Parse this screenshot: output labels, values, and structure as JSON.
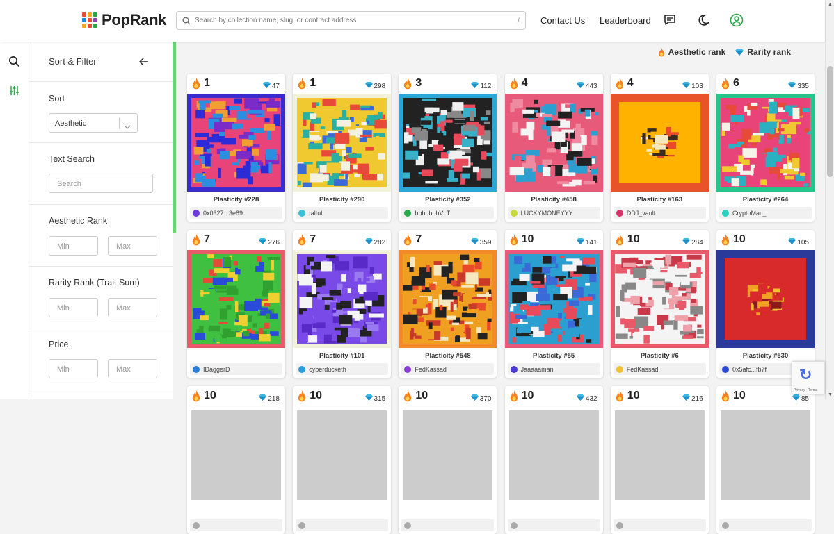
{
  "app": {
    "name": "PopRank",
    "logo_colors": [
      "#e84a3a",
      "#f5a623",
      "#2aa64b",
      "#1e88e5",
      "#e84a3a",
      "#8e44ad",
      "#f5a623",
      "#e84a3a",
      "#2aa64b"
    ]
  },
  "header": {
    "search_placeholder": "Search by collection name, slug, or contract address",
    "search_shortcut": "/",
    "contact_label": "Contact Us",
    "leaderboard_label": "Leaderboard"
  },
  "sidebar": {
    "title": "Sort & Filter",
    "sort_label": "Sort",
    "sort_value": "Aesthetic",
    "text_search_label": "Text Search",
    "text_search_placeholder": "Search",
    "aesthetic_label": "Aesthetic Rank",
    "rarity_label": "Rarity Rank (Trait Sum)",
    "price_label": "Price",
    "min_placeholder": "Min",
    "max_placeholder": "Max"
  },
  "legend": {
    "aesthetic": "Aesthetic rank",
    "rarity": "Rarity rank"
  },
  "colors": {
    "accent": "#6ad07a",
    "flame": "#f5821f",
    "diamond": "#3db8e6"
  },
  "cards": [
    {
      "rank": "1",
      "rarity": "47",
      "name": "Plasticity #228",
      "owner": "0x0327...3e89",
      "avatar": "#6a3bd8",
      "frame": "#3a2bd0",
      "palette": [
        "#e8447a",
        "#2b2bd8",
        "#f0a030",
        "#2a8fe0",
        "#7a2bc8"
      ]
    },
    {
      "rank": "1",
      "rarity": "298",
      "name": "Plasticity #290",
      "owner": "taltul",
      "avatar": "#3bbfd8",
      "frame": "#f2f1d9",
      "palette": [
        "#f0c830",
        "#e84a3a",
        "#3a6ad8",
        "#f4f1e0",
        "#2ab0a0"
      ]
    },
    {
      "rank": "3",
      "rarity": "112",
      "name": "Plasticity #352",
      "owner": "bbbbbbbVLT",
      "avatar": "#2aa64b",
      "frame": "#29a8d8",
      "palette": [
        "#222",
        "#f0f0f0",
        "#e84a5a",
        "#3ab0c8",
        "#888"
      ]
    },
    {
      "rank": "4",
      "rarity": "443",
      "name": "Plasticity #458",
      "owner": "LUCKYMONEYYY",
      "avatar": "#c8d83b",
      "frame": "#e85a7a",
      "palette": [
        "#e85a7a",
        "#f4f4f4",
        "#2a9fd0",
        "#222",
        "#f08aa0"
      ]
    },
    {
      "rank": "4",
      "rarity": "103",
      "name": "Plasticity #163",
      "owner": "DDJ_vault",
      "avatar": "#d8336a",
      "frame": "#e8532a",
      "palette": [
        "#ffb300",
        "#ffb300",
        "#e84a2a",
        "#f4e8c0",
        "#3a2a20"
      ]
    },
    {
      "rank": "6",
      "rarity": "335",
      "name": "Plasticity #264",
      "owner": "CryptoMac_",
      "avatar": "#2ad0c0",
      "frame": "#24c48a",
      "palette": [
        "#e8447a",
        "#f0c830",
        "#2ab0c0",
        "#f4f4e8",
        "#e84a3a"
      ]
    },
    {
      "rank": "7",
      "rarity": "276",
      "name": "",
      "owner": "IDaggerD",
      "avatar": "#2a7fd8",
      "frame": "#e85a6a",
      "palette": [
        "#40c040",
        "#f0d030",
        "#2a4ad8",
        "#e84a3a",
        "#30a030"
      ]
    },
    {
      "rank": "7",
      "rarity": "282",
      "name": "Plasticity #101",
      "owner": "cyberducketh",
      "avatar": "#2a9fd8",
      "frame": "#f2f1d9",
      "palette": [
        "#7a4ae8",
        "#f4f4f4",
        "#5a2ac8",
        "#222",
        "#9a7af0"
      ]
    },
    {
      "rank": "7",
      "rarity": "359",
      "name": "Plasticity #548",
      "owner": "FedKassad",
      "avatar": "#8a3bd8",
      "frame": "#f28a2a",
      "palette": [
        "#f0a020",
        "#e84a2a",
        "#222",
        "#f4e8c0",
        "#c83a2a"
      ]
    },
    {
      "rank": "10",
      "rarity": "141",
      "name": "Plasticity #55",
      "owner": "Jaaaaaman",
      "avatar": "#4a3bd8",
      "frame": "#e85a7a",
      "palette": [
        "#2a9fd0",
        "#e84a5a",
        "#f4f4f4",
        "#222",
        "#3a6ad8"
      ]
    },
    {
      "rank": "10",
      "rarity": "284",
      "name": "Plasticity #6",
      "owner": "FedKassad",
      "avatar": "#f0c030",
      "frame": "#e85a6a",
      "palette": [
        "#f4f4f4",
        "#e85a6a",
        "#c83a4a",
        "#888",
        "#f0a0a8"
      ]
    },
    {
      "rank": "10",
      "rarity": "105",
      "name": "Plasticity #530",
      "owner": "0x5afc...fb7f",
      "avatar": "#2a4ad8",
      "frame": "#2a3a9a",
      "palette": [
        "#d82a2a",
        "#d82a2a",
        "#f0a020",
        "#8a1a1a",
        "#f4c030"
      ]
    },
    {
      "rank": "10",
      "rarity": "218",
      "name": "",
      "owner": "",
      "avatar": "#aaa",
      "frame": "#fff",
      "palette": [
        "#ccc"
      ]
    },
    {
      "rank": "10",
      "rarity": "315",
      "name": "",
      "owner": "",
      "avatar": "#aaa",
      "frame": "#fff",
      "palette": [
        "#ccc"
      ]
    },
    {
      "rank": "10",
      "rarity": "370",
      "name": "",
      "owner": "",
      "avatar": "#aaa",
      "frame": "#fff",
      "palette": [
        "#ccc"
      ]
    },
    {
      "rank": "10",
      "rarity": "432",
      "name": "",
      "owner": "",
      "avatar": "#aaa",
      "frame": "#fff",
      "palette": [
        "#ccc"
      ]
    },
    {
      "rank": "10",
      "rarity": "216",
      "name": "",
      "owner": "",
      "avatar": "#aaa",
      "frame": "#fff",
      "palette": [
        "#ccc"
      ]
    },
    {
      "rank": "10",
      "rarity": "85",
      "name": "",
      "owner": "",
      "avatar": "#aaa",
      "frame": "#fff",
      "palette": [
        "#ccc"
      ]
    }
  ],
  "recaptcha": {
    "text": "Privacy - Terms"
  }
}
